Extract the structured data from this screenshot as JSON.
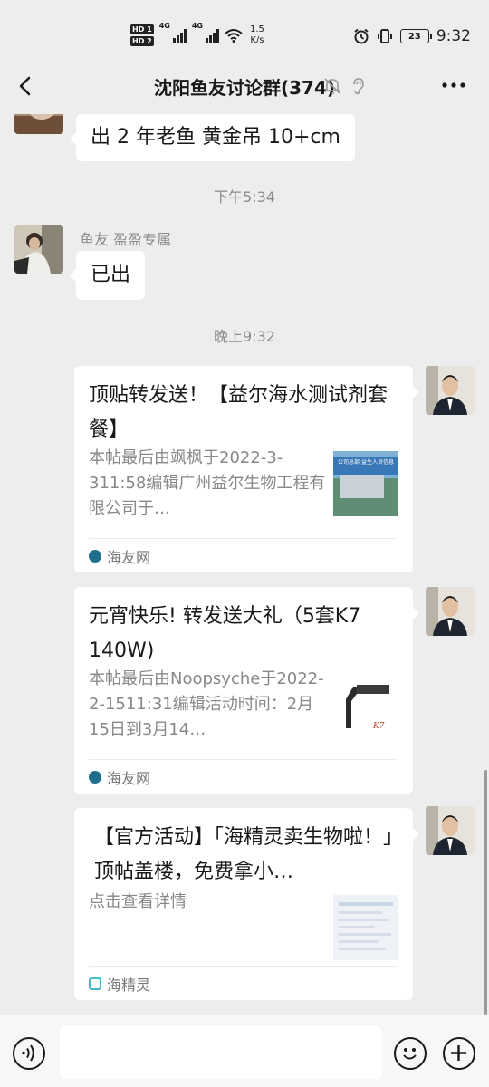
{
  "status_bar": {
    "hd1": "HD 1",
    "hd2": "HD 2",
    "net1": "4G",
    "net2": "4G",
    "speed_value": "1.5",
    "speed_unit": "K/s",
    "battery": "23",
    "time": "9:32"
  },
  "nav": {
    "title": "沈阳鱼友讨论群(374)",
    "back_icon": "back-chevron-icon",
    "mute_icon": "bell-muted-icon",
    "earpiece_icon": "ear-icon",
    "more_icon": "ellipsis-icon"
  },
  "messages": {
    "m1": {
      "text": "出 2 年老鱼 黄金吊 10+cm"
    },
    "ts1": "下午5:34",
    "m2": {
      "sender": "鱼友 盈盈专属",
      "text": "已出"
    },
    "ts2": "晚上9:32",
    "cards": [
      {
        "title": "顶贴转发送！【益尔海水测试剂套餐】",
        "desc": "本帖最后由飒枫于2022-3-311:58编辑广州益尔生物工程有限公司于…",
        "source": "海友网",
        "thumb_text": "公司总部 益生人员信息"
      },
      {
        "title": "元宵快乐! 转发送大礼（5套K7 140W)",
        "desc": "本帖最后由Noopsyche于2022-2-1511:31编辑活动时间：2月15日到3月14…",
        "source": "海友网",
        "thumb_text": "K7"
      },
      {
        "title": "【官方活动】「海精灵卖生物啦！」顶帖盖楼，免费拿小…",
        "desc": "点击查看详情",
        "source": "海精灵"
      }
    ]
  },
  "colors": {
    "background": "#ededed",
    "bubble": "#ffffff",
    "timestamp": "#8c8c8c",
    "source_dot": "#1f6e8c"
  }
}
